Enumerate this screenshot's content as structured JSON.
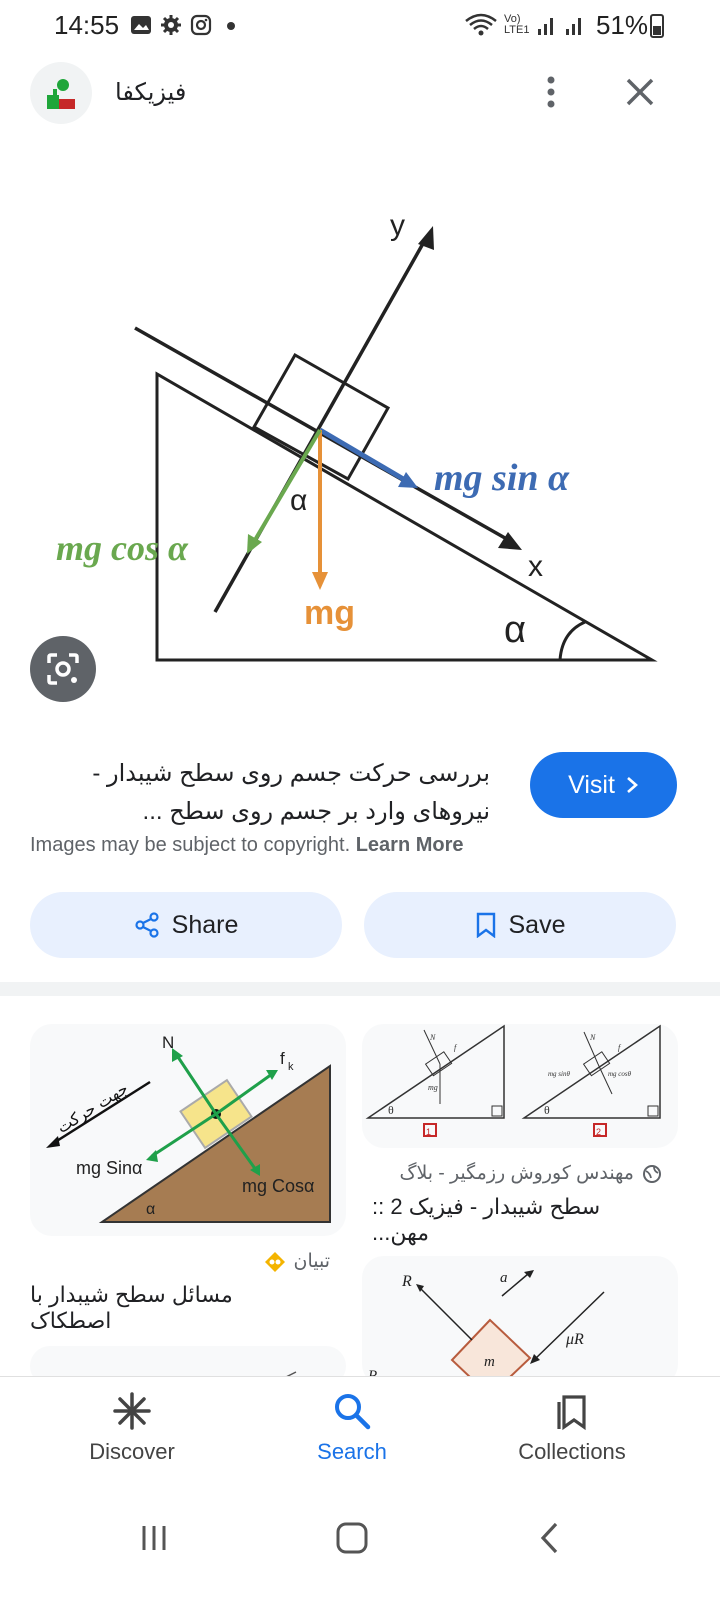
{
  "status_bar": {
    "time": "14:55",
    "battery": "51%",
    "lte_label": "Vo) LTE1"
  },
  "header": {
    "site_name": "فیزیکفا"
  },
  "hero_image": {
    "labels": {
      "y_axis": "y",
      "x_axis": "x",
      "mg_sin": "mg sin α",
      "mg_cos": "mg cos α",
      "mg": "mg",
      "alpha": "α",
      "alpha_inner": "α"
    }
  },
  "result": {
    "title_line1": "بررسی حرکت جسم روی سطح شیبدار -",
    "title_line2": "نیروهای وارد بر جسم روی سطح ...",
    "visit_label": "Visit",
    "copyright_text": "Images may be subject to copyright.",
    "learn_more": "Learn More"
  },
  "actions": {
    "share_label": "Share",
    "save_label": "Save"
  },
  "related": [
    {
      "source": "تبیان",
      "caption": "مسائل سطح شیبدار با اصطکاک",
      "image_labels": {
        "n": "N",
        "fk": "f",
        "fk_sub": "k",
        "sin": "mg Sinα",
        "cos": "mg Cosα",
        "alpha": "α",
        "direction": "جهت حرکت"
      }
    },
    {
      "source": "مهندس کوروش رزمگیر - بلاگ",
      "caption": "سطح شیبدار - فیزیک 2 :: مهن...",
      "image_labels": {
        "box1": "1",
        "box2": "2",
        "theta": "θ",
        "mg": "mg",
        "mg_sin": "mg sinθ",
        "mg_cos": "mg cosθ",
        "n": "N",
        "f": "f"
      }
    },
    {
      "source": "",
      "caption": "",
      "image_labels": {
        "r": "R",
        "a": "a",
        "mu_r": "μR",
        "m": "m",
        "p": "P"
      }
    }
  ],
  "bottom_nav": {
    "discover": "Discover",
    "search": "Search",
    "collections": "Collections"
  },
  "colors": {
    "accent": "#1a73e8",
    "chip_bg": "#e8f0fe",
    "green_force": "#6aa84f",
    "blue_force": "#3d6bb3",
    "orange_force": "#e69138"
  }
}
